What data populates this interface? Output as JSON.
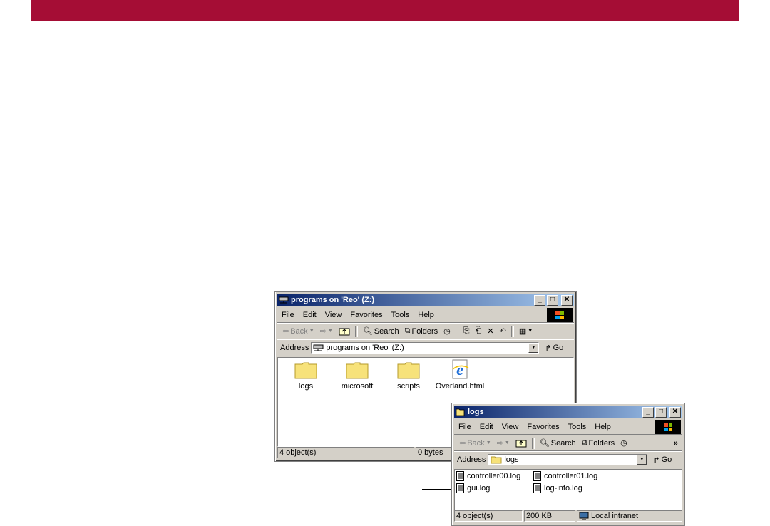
{
  "window_main": {
    "title": "programs on 'Reo' (Z:)",
    "menu": [
      "File",
      "Edit",
      "View",
      "Favorites",
      "Tools",
      "Help"
    ],
    "toolbar": {
      "back": "Back",
      "search": "Search",
      "folders": "Folders"
    },
    "address": {
      "label": "Address",
      "value": "programs on 'Reo' (Z:)",
      "go": "Go"
    },
    "items": [
      "logs",
      "microsoft",
      "scripts",
      "Overland.html"
    ],
    "status": {
      "objects": "4 object(s)",
      "size": "0 bytes"
    }
  },
  "window_logs": {
    "title": "logs",
    "menu": [
      "File",
      "Edit",
      "View",
      "Favorites",
      "Tools",
      "Help"
    ],
    "toolbar": {
      "back": "Back",
      "search": "Search",
      "folders": "Folders",
      "more": "»"
    },
    "address": {
      "label": "Address",
      "value": "logs",
      "go": "Go"
    },
    "files": [
      "controller00.log",
      "controller01.log",
      "gui.log",
      "log-info.log"
    ],
    "status": {
      "objects": "4 object(s)",
      "size": "200 KB",
      "zone": "Local intranet"
    }
  },
  "colors": {
    "banner": "#a50d35",
    "titlebar_start": "#0a246a",
    "titlebar_end": "#a6caf0",
    "window_face": "#d4d0c8"
  },
  "icons": [
    "folder-icon",
    "ie-html-icon",
    "text-file-icon",
    "network-drive-icon",
    "windows-logo-icon",
    "intranet-zone-icon"
  ]
}
